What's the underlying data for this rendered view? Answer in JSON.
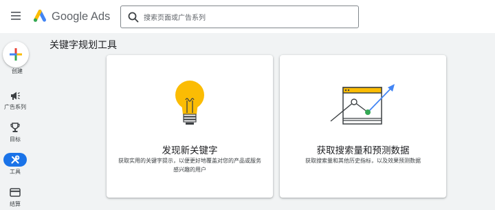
{
  "header": {
    "app_name": "Google Ads",
    "search_placeholder": "搜索页面或广告系列"
  },
  "nav": {
    "create_label": "创建",
    "campaigns_label": "广告系列",
    "goals_label": "目标",
    "tools_label": "工具",
    "billing_label": "结算"
  },
  "page": {
    "title": "关键字规划工具"
  },
  "cards": [
    {
      "title": "发现新关键字",
      "description": "获取实用的关键字提示，以便更好地覆盖对您的产品或服务感兴趣的用户",
      "icon": "lightbulb-icon"
    },
    {
      "title": "获取搜索量和预测数据",
      "description": "获取搜索量和其他历史指标，以及效果预测数据",
      "icon": "trend-chart-icon"
    }
  ],
  "colors": {
    "accent_blue": "#1a73e8",
    "bulb_yellow": "#fbbc04",
    "logo_green": "#34a853",
    "logo_red": "#ea4335"
  }
}
